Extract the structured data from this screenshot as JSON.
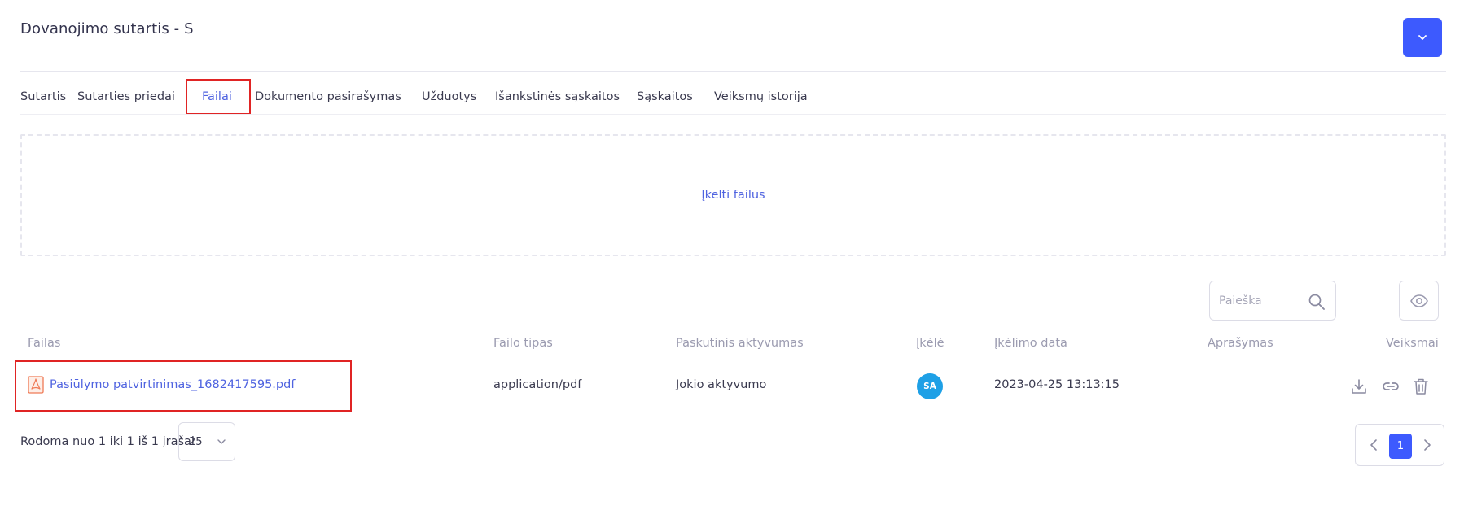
{
  "header": {
    "title": "Dovanojimo sutartis - S",
    "menu_icon": "chevron-down-icon",
    "accent_color": "#3d5afe"
  },
  "tabs": [
    {
      "label": "Sutartis",
      "active": false
    },
    {
      "label": "Sutarties priedai",
      "active": false
    },
    {
      "label": "Failai",
      "active": true
    },
    {
      "label": "Dokumento pasirašymas",
      "active": false
    },
    {
      "label": "Užduotys",
      "active": false
    },
    {
      "label": "Išankstinės sąskaitos",
      "active": false
    },
    {
      "label": "Sąskaitos",
      "active": false
    },
    {
      "label": "Veiksmų istorija",
      "active": false
    }
  ],
  "upload": {
    "label": "Įkelti failus"
  },
  "search": {
    "placeholder": "Paieška",
    "value": "",
    "icon": "search-icon"
  },
  "visibility_toggle": {
    "icon": "eye-icon"
  },
  "table": {
    "columns": [
      "Failas",
      "Failo tipas",
      "Paskutinis aktyvumas",
      "Įkėlė",
      "Įkėlimo data",
      "Aprašymas",
      "Veiksmai"
    ],
    "rows": [
      {
        "file_name": "Pasiūlymo patvirtinimas_1682417595.pdf",
        "file_icon": "pdf-icon",
        "file_type": "application/pdf",
        "last_activity": "Jokio aktyvumo",
        "uploader_initials": "SA",
        "upload_date": "2023-04-25 13:13:15",
        "description": "",
        "actions": [
          "download-icon",
          "link-icon",
          "trash-icon"
        ]
      }
    ]
  },
  "footer": {
    "info": "Rodoma nuo 1 iki 1 iš 1 įrašai",
    "page_size": "25",
    "current_page": "1"
  }
}
